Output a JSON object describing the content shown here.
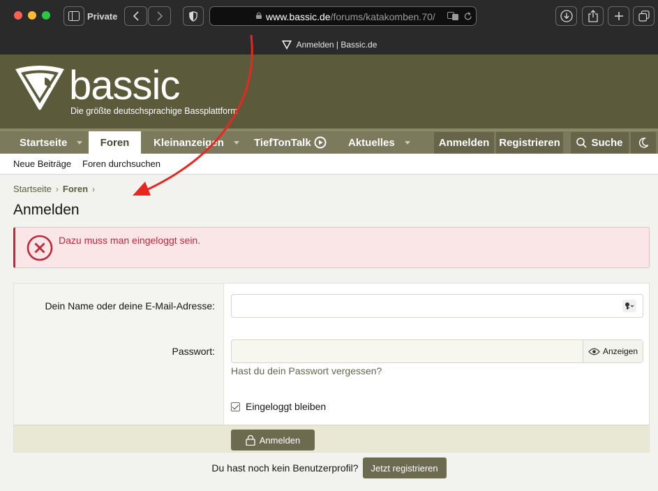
{
  "browser": {
    "private_label": "Private",
    "url_domain": "www.bassic.de",
    "url_path": "/forums/katakomben.70/",
    "tab_title": "Anmelden | Bassic.de"
  },
  "site": {
    "brand": "bassic",
    "tagline": "Die größte deutschsprachige Bassplattform"
  },
  "nav": {
    "items": [
      {
        "label": "Startseite"
      },
      {
        "label": "Foren"
      },
      {
        "label": "Kleinanzeigen"
      },
      {
        "label": "TiefTonTalk"
      },
      {
        "label": "Aktuelles"
      }
    ],
    "login": "Anmelden",
    "register": "Registrieren",
    "search": "Suche"
  },
  "subnav": {
    "new_posts": "Neue Beiträge",
    "search_forums": "Foren durchsuchen"
  },
  "breadcrumb": {
    "home": "Startseite",
    "forums": "Foren"
  },
  "page": {
    "title": "Anmelden",
    "error": "Dazu muss man eingeloggt sein."
  },
  "form": {
    "username_label": "Dein Name oder deine E-Mail-Adresse:",
    "username_value": "",
    "password_label": "Passwort:",
    "password_value": "",
    "show_password": "Anzeigen",
    "forgot": "Hast du dein Passwort vergessen?",
    "remember": "Eingeloggt bleiben",
    "submit": "Anmelden"
  },
  "register": {
    "prompt": "Du hast noch kein Benutzerprofil?",
    "button": "Jetzt registrieren"
  },
  "colors": {
    "header_bg": "#5b5b3b",
    "nav_bg": "#7b7a5c",
    "accent": "#6c6b4f",
    "error": "#c0283a"
  }
}
